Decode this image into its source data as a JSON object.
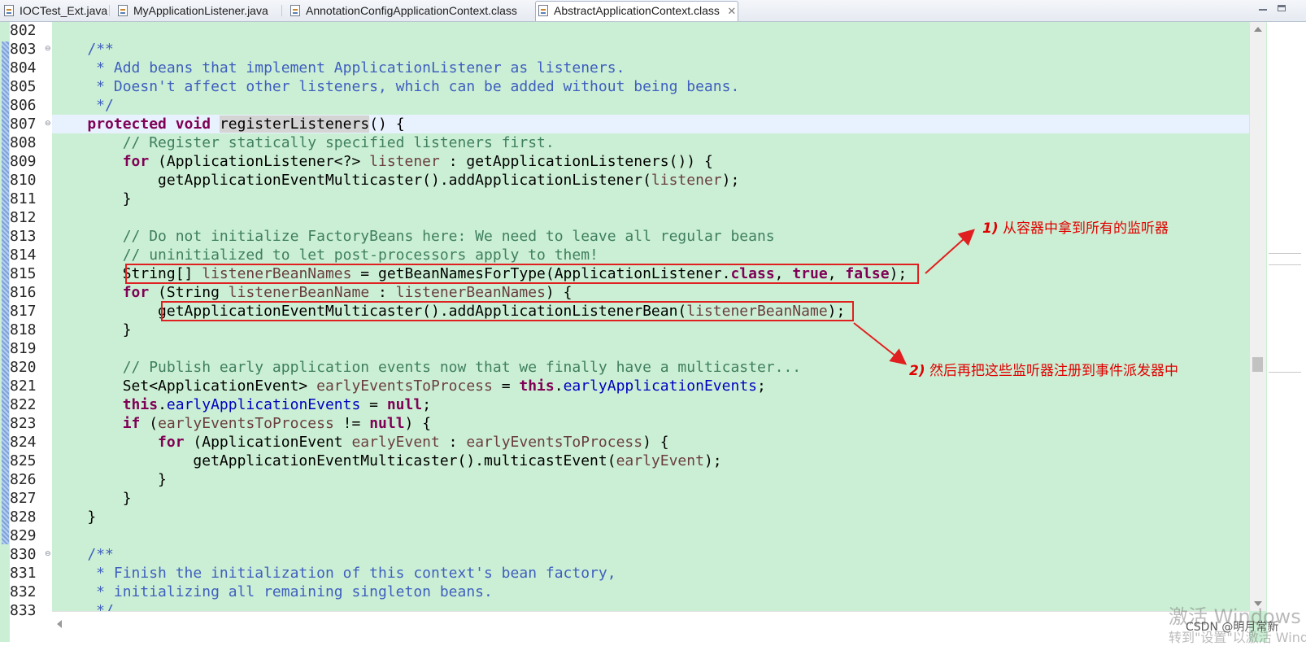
{
  "tabs": [
    {
      "label": "IOCTest_Ext.java",
      "active": false
    },
    {
      "label": "MyApplicationListener.java",
      "active": false
    },
    {
      "label": "AnnotationConfigApplicationContext.class",
      "active": false
    },
    {
      "label": "AbstractApplicationContext.class",
      "active": true,
      "close": "✕"
    }
  ],
  "code_lines": [
    {
      "n": "802",
      "tokens": []
    },
    {
      "n": "803",
      "fold": "⊖",
      "tokens": [
        [
          "    ",
          ""
        ],
        [
          "/**",
          "jd"
        ]
      ]
    },
    {
      "n": "804",
      "tokens": [
        [
          "     * Add beans that implement ApplicationListener as listeners.",
          "jd"
        ]
      ]
    },
    {
      "n": "805",
      "tokens": [
        [
          "     * Doesn't affect other listeners, which can be added without being beans.",
          "jd"
        ]
      ]
    },
    {
      "n": "806",
      "tokens": [
        [
          "     */",
          "jd"
        ]
      ]
    },
    {
      "n": "807",
      "fold": "⊖",
      "current": true,
      "tokens": [
        [
          "    ",
          ""
        ],
        [
          "protected",
          "kw"
        ],
        [
          " ",
          ""
        ],
        [
          "void",
          "kw"
        ],
        [
          " ",
          ""
        ],
        [
          "registerListeners",
          "occ"
        ],
        [
          "() {",
          ""
        ]
      ]
    },
    {
      "n": "808",
      "tokens": [
        [
          "        ",
          ""
        ],
        [
          "// Register statically specified listeners first.",
          "cm"
        ]
      ]
    },
    {
      "n": "809",
      "tokens": [
        [
          "        ",
          ""
        ],
        [
          "for",
          "kw"
        ],
        [
          " (ApplicationListener<?> ",
          ""
        ],
        [
          "listener",
          "vr"
        ],
        [
          " : getApplicationListeners()) {",
          ""
        ]
      ]
    },
    {
      "n": "810",
      "tokens": [
        [
          "            getApplicationEventMulticaster().addApplicationListener(",
          ""
        ],
        [
          "listener",
          "vr"
        ],
        [
          ");",
          ""
        ]
      ]
    },
    {
      "n": "811",
      "tokens": [
        [
          "        }",
          ""
        ]
      ]
    },
    {
      "n": "812",
      "tokens": []
    },
    {
      "n": "813",
      "tokens": [
        [
          "        ",
          ""
        ],
        [
          "// Do not initialize FactoryBeans here: We need to leave all regular beans",
          "cm"
        ]
      ]
    },
    {
      "n": "814",
      "tokens": [
        [
          "        ",
          ""
        ],
        [
          "// uninitialized to let post-processors apply to them!",
          "cm"
        ]
      ]
    },
    {
      "n": "815",
      "tokens": [
        [
          "        String[] ",
          ""
        ],
        [
          "listenerBeanNames",
          "vr"
        ],
        [
          " = getBeanNamesForType(ApplicationListener.",
          ""
        ],
        [
          "class",
          "kw"
        ],
        [
          ", ",
          ""
        ],
        [
          "true",
          "kw"
        ],
        [
          ", ",
          ""
        ],
        [
          "false",
          "kw"
        ],
        [
          ");",
          ""
        ]
      ]
    },
    {
      "n": "816",
      "tokens": [
        [
          "        ",
          ""
        ],
        [
          "for",
          "kw"
        ],
        [
          " (String ",
          ""
        ],
        [
          "listenerBeanName",
          "vr"
        ],
        [
          " : ",
          ""
        ],
        [
          "listenerBeanNames",
          "vr"
        ],
        [
          ") {",
          ""
        ]
      ]
    },
    {
      "n": "817",
      "tokens": [
        [
          "            getApplicationEventMulticaster().addApplicationListenerBean(",
          ""
        ],
        [
          "listenerBeanName",
          "vr"
        ],
        [
          ");",
          ""
        ]
      ]
    },
    {
      "n": "818",
      "tokens": [
        [
          "        }",
          ""
        ]
      ]
    },
    {
      "n": "819",
      "tokens": []
    },
    {
      "n": "820",
      "tokens": [
        [
          "        ",
          ""
        ],
        [
          "// Publish early application events now that we finally have a multicaster...",
          "cm"
        ]
      ]
    },
    {
      "n": "821",
      "tokens": [
        [
          "        Set<ApplicationEvent> ",
          ""
        ],
        [
          "earlyEventsToProcess",
          "vr"
        ],
        [
          " = ",
          ""
        ],
        [
          "this",
          "kw"
        ],
        [
          ".",
          ""
        ],
        [
          "earlyApplicationEvents",
          "fd"
        ],
        [
          ";",
          ""
        ]
      ]
    },
    {
      "n": "822",
      "tokens": [
        [
          "        ",
          ""
        ],
        [
          "this",
          "kw"
        ],
        [
          ".",
          ""
        ],
        [
          "earlyApplicationEvents",
          "fd"
        ],
        [
          " = ",
          ""
        ],
        [
          "null",
          "kw"
        ],
        [
          ";",
          ""
        ]
      ]
    },
    {
      "n": "823",
      "tokens": [
        [
          "        ",
          ""
        ],
        [
          "if",
          "kw"
        ],
        [
          " (",
          ""
        ],
        [
          "earlyEventsToProcess",
          "vr"
        ],
        [
          " != ",
          ""
        ],
        [
          "null",
          "kw"
        ],
        [
          ") {",
          ""
        ]
      ]
    },
    {
      "n": "824",
      "tokens": [
        [
          "            ",
          ""
        ],
        [
          "for",
          "kw"
        ],
        [
          " (ApplicationEvent ",
          ""
        ],
        [
          "earlyEvent",
          "vr"
        ],
        [
          " : ",
          ""
        ],
        [
          "earlyEventsToProcess",
          "vr"
        ],
        [
          ") {",
          ""
        ]
      ]
    },
    {
      "n": "825",
      "tokens": [
        [
          "                getApplicationEventMulticaster().multicastEvent(",
          ""
        ],
        [
          "earlyEvent",
          "vr"
        ],
        [
          ");",
          ""
        ]
      ]
    },
    {
      "n": "826",
      "tokens": [
        [
          "            }",
          ""
        ]
      ]
    },
    {
      "n": "827",
      "tokens": [
        [
          "        }",
          ""
        ]
      ]
    },
    {
      "n": "828",
      "tokens": [
        [
          "    }",
          ""
        ]
      ]
    },
    {
      "n": "829",
      "tokens": []
    },
    {
      "n": "830",
      "fold": "⊖",
      "tokens": [
        [
          "    ",
          ""
        ],
        [
          "/**",
          "jd"
        ]
      ]
    },
    {
      "n": "831",
      "tokens": [
        [
          "     * Finish the initialization of this context's bean factory,",
          "jd"
        ]
      ]
    },
    {
      "n": "832",
      "tokens": [
        [
          "     * initializing all remaining singleton beans.",
          "jd"
        ]
      ]
    },
    {
      "n": "833",
      "tokens": [
        [
          "     */",
          "jd"
        ]
      ]
    }
  ],
  "annotations": {
    "note1_num": "1)",
    "note1_text": "从容器中拿到所有的监听器",
    "note2_num": "2)",
    "note2_text": "然后再把这些监听器注册到事件派发器中",
    "color": "#e00000"
  },
  "watermark": {
    "line1": "激活 Windows",
    "line2": "转到\"设置\"以激活 Windows。",
    "credit": "CSDN @明月常新"
  },
  "colors": {
    "editor_bg": "#cbefd4",
    "keyword": "#7f0055",
    "comment": "#3f7f5f",
    "javadoc": "#3f5fbf",
    "variable": "#6a3e3e",
    "field": "#0000c0"
  }
}
